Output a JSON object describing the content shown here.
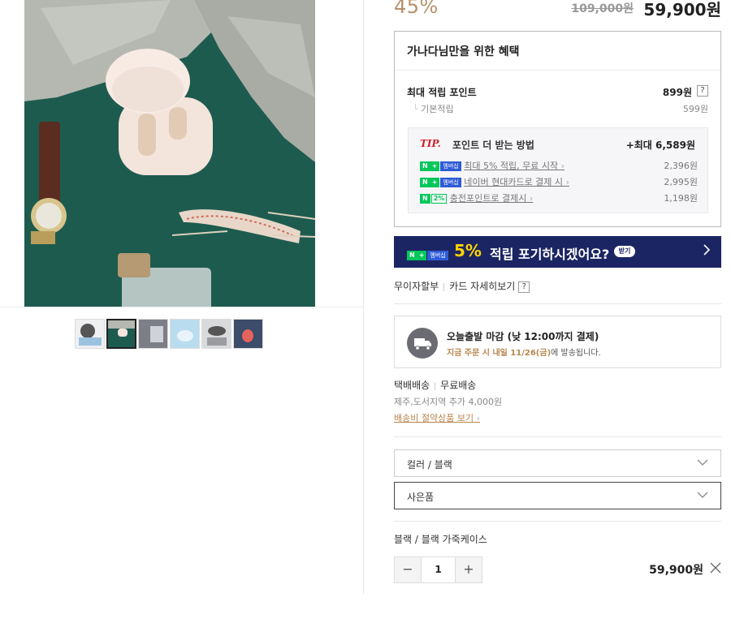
{
  "price": {
    "discount": "45%",
    "original": "109,000원",
    "sale": "59,900원"
  },
  "benefit": {
    "title": "가나다님만을 위한 혜택",
    "max_points_label": "최대 적립 포인트",
    "max_points_value": "899원",
    "help": "?",
    "base_label": "기본적립",
    "base_value": "599원",
    "tip": {
      "mark": "TIP.",
      "title": "포인트 더 받는 방법",
      "max": "+최대 6,589원",
      "items": [
        {
          "text": "최대 5% 적립, 무료 시작",
          "amount": "2,396원"
        },
        {
          "text": "네이버 현대카드로 결제 시",
          "amount": "2,995원"
        },
        {
          "text": "충전포인트로 결제시",
          "amount": "1,198원"
        }
      ]
    }
  },
  "badges": {
    "n": "N",
    "plus": "+",
    "membership": "멤버십",
    "pct": "2%"
  },
  "banner": {
    "highlight": "5%",
    "text": "적립 포기하시겠어요?",
    "pill": "받기"
  },
  "card": {
    "installment": "무이자할부",
    "detail": "카드 자세히보기"
  },
  "shipping": {
    "title": "오늘출발 마감 (낮 12:00까지 결제)",
    "sub_highlight": "지금 주문 시 내일 11/26(금)",
    "sub_rest": "에 발송됩니다.",
    "method": "택배배송",
    "fee": "무료배송",
    "extra": "제주,도서지역 추가 4,000원",
    "saving_link": "배송비 절약상품 보기"
  },
  "options": {
    "color": "컬러 / 블랙",
    "gift": "사은품"
  },
  "selected": {
    "name": "블랙 / 블랙 가죽케이스",
    "qty": "1",
    "minus": "−",
    "plus": "+",
    "price": "59,900원"
  },
  "colors": {
    "accent": "#b8864f",
    "banner_bg": "#1c2563",
    "banner_yellow": "#ffd400",
    "naver_green": "#03c75a",
    "tip_red": "#d21e2b"
  },
  "icons": [
    "truck-icon",
    "chevron-down-icon",
    "close-icon",
    "chevron-right-icon"
  ]
}
